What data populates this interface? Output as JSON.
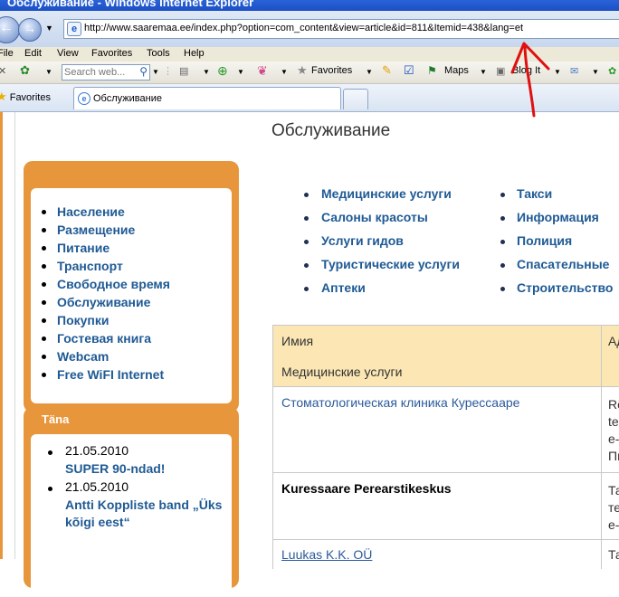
{
  "window": {
    "title": "Обслуживание - Windows Internet Explorer"
  },
  "address_bar": {
    "url": "http://www.saaremaa.ee/index.php?option=com_content&view=article&id=811&Itemid=438&lang=et"
  },
  "menu": [
    "File",
    "Edit",
    "View",
    "Favorites",
    "Tools",
    "Help"
  ],
  "toolbar": {
    "search_placeholder": "Search web...",
    "favorites_label": "Favorites",
    "maps_label": "Maps",
    "blog_label": "Blog It"
  },
  "tabs": {
    "favorites_label": "Favorites",
    "active_tab": "Обслуживание"
  },
  "sidebar": {
    "menu_items": [
      "Население",
      "Размещение",
      "Питание",
      "Транспорт",
      "Свободное время",
      "Обслуживание",
      "Покупки",
      "Гостевая книга",
      "Webcam",
      "Free WiFI Internet"
    ],
    "tana": {
      "title": "Täna",
      "news": [
        {
          "date": "21.05.2010",
          "title_lines": [
            "SUPER 90-ndad!"
          ]
        },
        {
          "date": "21.05.2010",
          "title_lines": [
            "Antti Koppliste band „Üks",
            "kõigi eest“"
          ]
        }
      ]
    }
  },
  "content": {
    "title": "Обслуживание",
    "services_left": [
      "Медицинские услуги",
      "Салоны красоты",
      "Услуги гидов",
      "Туристические услуги",
      "Аптеки"
    ],
    "services_right": [
      "Такси",
      "Информация",
      "Полиция",
      "Спасательные",
      "Строительство"
    ],
    "table": {
      "header": [
        "Имия",
        "Ад"
      ],
      "section": "Медицинские услуги",
      "rows": [
        {
          "name": "Стоматологическая клиника Курессааре",
          "info": [
            "Rõ",
            "te",
            "e-",
            "Пн"
          ]
        },
        {
          "name": "Kuressaare Perearstikeskus",
          "info": [
            "Та",
            "те",
            "e-"
          ]
        },
        {
          "name": "Luukas K.K. OÜ",
          "info": [
            "Та"
          ]
        }
      ]
    }
  },
  "colors": {
    "accent_orange": "#e8963c",
    "link_blue": "#1f5a94",
    "table_header": "#fbe6b4",
    "annotation_red": "#e01010"
  }
}
